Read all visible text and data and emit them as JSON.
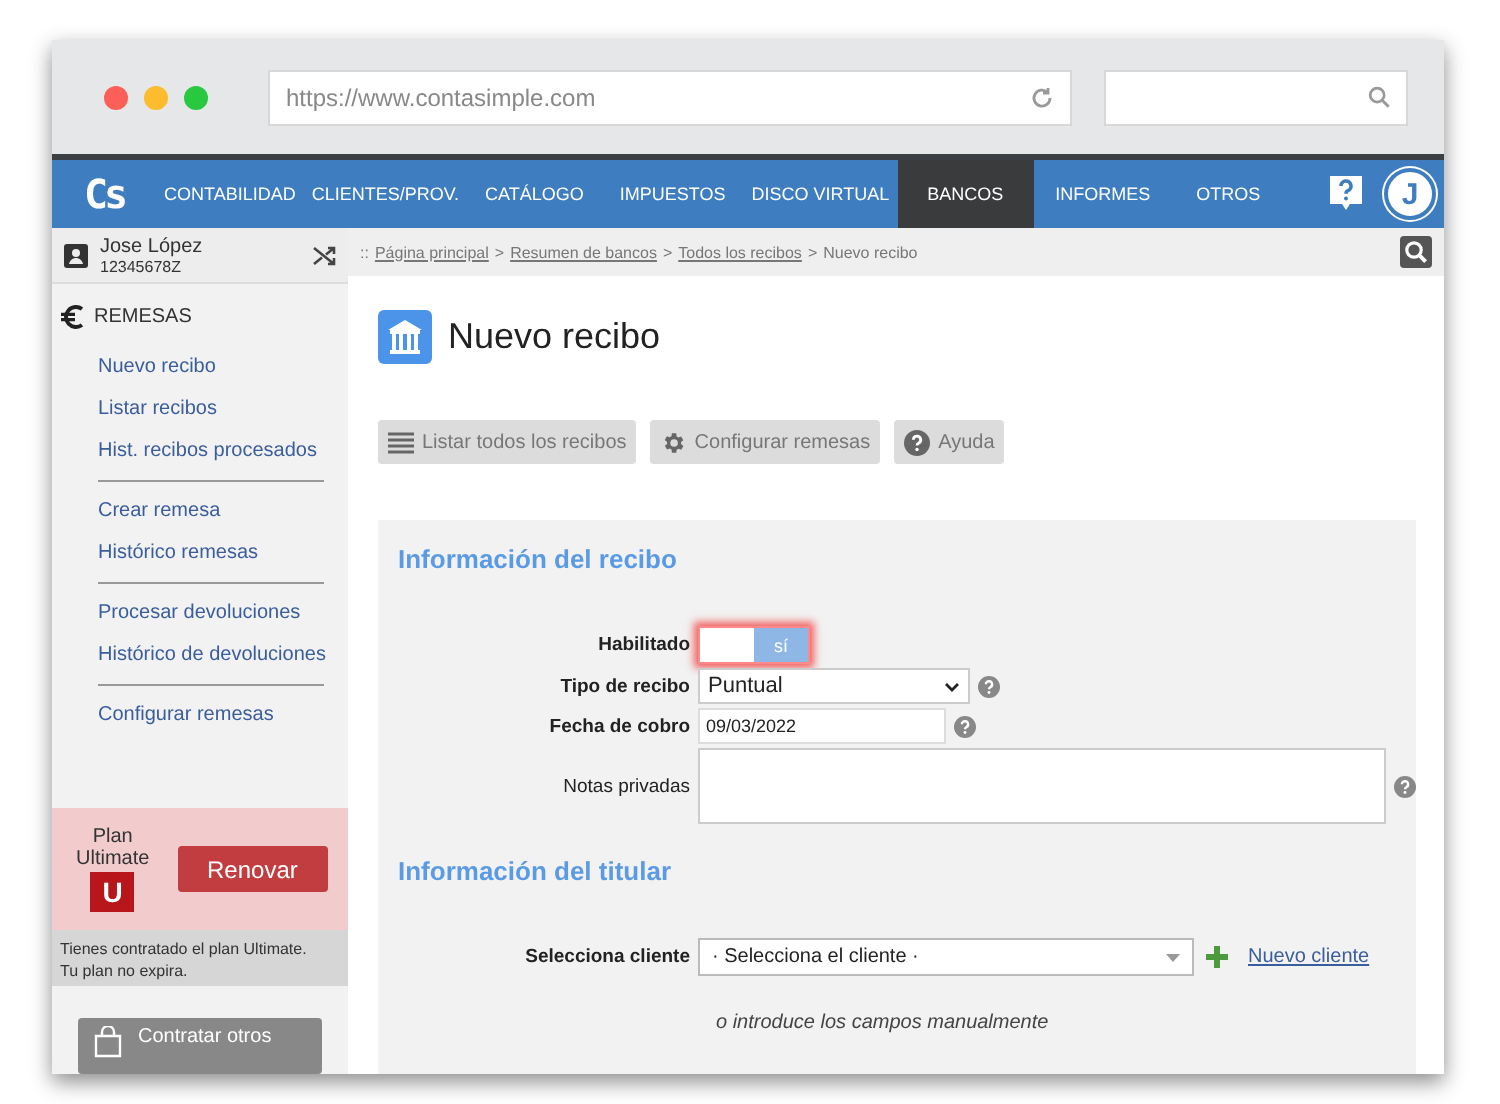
{
  "browser": {
    "url": "https://www.contasimple.com"
  },
  "nav": {
    "logo": "Cs",
    "items": [
      {
        "label": "CONTABILIDAD",
        "selected": false
      },
      {
        "label": "CLIENTES/PROV.",
        "selected": false
      },
      {
        "label": "CATÁLOGO",
        "selected": false
      },
      {
        "label": "IMPUESTOS",
        "selected": false
      },
      {
        "label": "DISCO VIRTUAL",
        "selected": false
      },
      {
        "label": "BANCOS",
        "selected": true
      },
      {
        "label": "INFORMES",
        "selected": false
      },
      {
        "label": "OTROS",
        "selected": false
      }
    ],
    "avatar": "J"
  },
  "user": {
    "name": "Jose López",
    "id": "12345678Z"
  },
  "sidebar": {
    "title": "REMESAS",
    "groups": [
      [
        {
          "label": "Nuevo recibo"
        },
        {
          "label": "Listar recibos"
        },
        {
          "label": "Hist. recibos procesados"
        }
      ],
      [
        {
          "label": "Crear remesa"
        },
        {
          "label": "Histórico remesas"
        }
      ],
      [
        {
          "label": "Procesar devoluciones"
        },
        {
          "label": "Histórico de devoluciones"
        }
      ],
      [
        {
          "label": "Configurar remesas"
        }
      ]
    ],
    "plan": {
      "label": "Plan",
      "name": "Ultimate",
      "badge": "U",
      "button": "Renovar",
      "notice": [
        "Tienes contratado el plan Ultimate.",
        "Tu plan no expira."
      ]
    },
    "contract_button": "Contratar otros"
  },
  "breadcrumb": {
    "prefix": "::",
    "separator": ">",
    "items": [
      {
        "label": "Página principal",
        "kind": "link"
      },
      {
        "label": "Resumen de bancos",
        "kind": "link"
      },
      {
        "label": "Todos los recibos",
        "kind": "link"
      },
      {
        "label": "Nuevo recibo",
        "kind": "current"
      }
    ]
  },
  "page_title": "Nuevo recibo",
  "toolbar": [
    {
      "label": "Listar todos los recibos",
      "kind": "list"
    },
    {
      "label": "Configurar remesas",
      "kind": "gear"
    },
    {
      "label": "Ayuda",
      "kind": "help"
    }
  ],
  "sections": [
    {
      "title": "Información del recibo",
      "fields": [
        {
          "kind": "toggle",
          "label": "Habilitado",
          "required": true,
          "on": true,
          "value": "sí"
        },
        {
          "kind": "select",
          "label": "Tipo de recibo",
          "required": true,
          "value": "Puntual",
          "help": true
        },
        {
          "kind": "input",
          "label": "Fecha de cobro",
          "required": true,
          "value": "09/03/2022",
          "help": true
        },
        {
          "kind": "textarea",
          "label": "Notas privadas",
          "required": false,
          "help": true
        }
      ]
    },
    {
      "title": "Información del titular",
      "fields": [
        {
          "kind": "client",
          "label": "Selecciona cliente",
          "required": true,
          "placeholder": "· Selecciona el cliente ·",
          "link": "Nuevo cliente"
        }
      ],
      "hint": "o introduce los campos manualmente"
    }
  ]
}
